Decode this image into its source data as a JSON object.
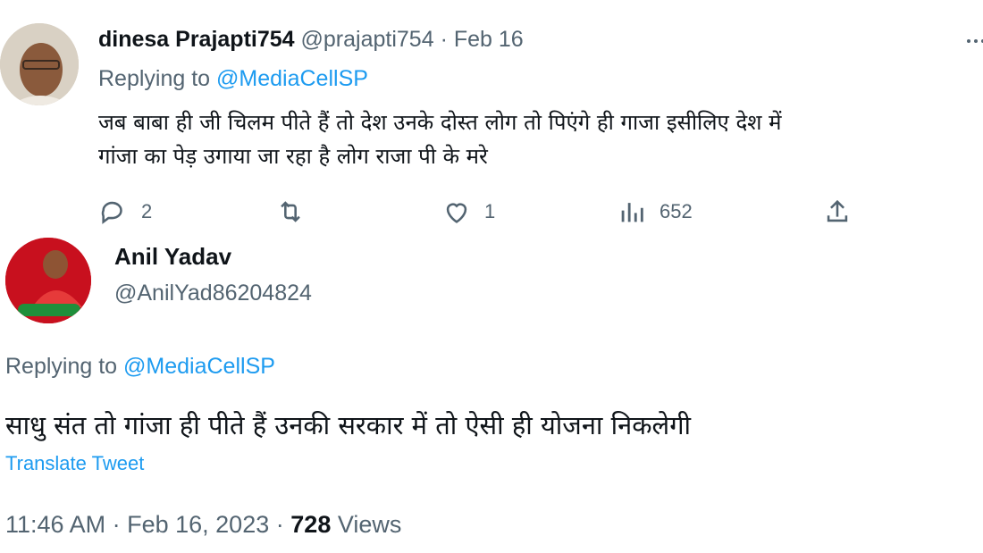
{
  "tweet1": {
    "display_name": "dinesa Prajapti754",
    "handle": "@prajapti754",
    "separator": "·",
    "date": "Feb 16",
    "more_icon": "more-dots-icon",
    "replying_prefix": "Replying to",
    "replying_handle": "@MediaCellSP",
    "text_line1": "जब बाबा ही जी चिलम पीते हैं तो देश उनके दोस्त लोग तो पिएंगे ही गाजा इसीलिए देश में",
    "text_line2": "गांजा का पेड़ उगाया जा रहा है लोग राजा पी के मरे",
    "actions": {
      "reply_count": "2",
      "retweet_count": "",
      "like_count": "1",
      "views_count": "652"
    }
  },
  "tweet2": {
    "display_name": "Anil Yadav",
    "handle": "@AnilYad86204824",
    "replying_prefix": "Replying to",
    "replying_handle": "@MediaCellSP",
    "text": "साधु संत तो गांजा ही पीते हैं उनकी सरकार में तो ऐसी ही योजना निकलेगी",
    "translate_label": "Translate Tweet",
    "time": "11:46 AM",
    "dot1": "·",
    "date": "Feb 16, 2023",
    "dot2": "·",
    "views_count": "728",
    "views_label": "Views"
  },
  "colors": {
    "link": "#1d9bf0",
    "muted": "#536471",
    "text": "#0f1419",
    "avatar2_bg": "#c8101e"
  }
}
